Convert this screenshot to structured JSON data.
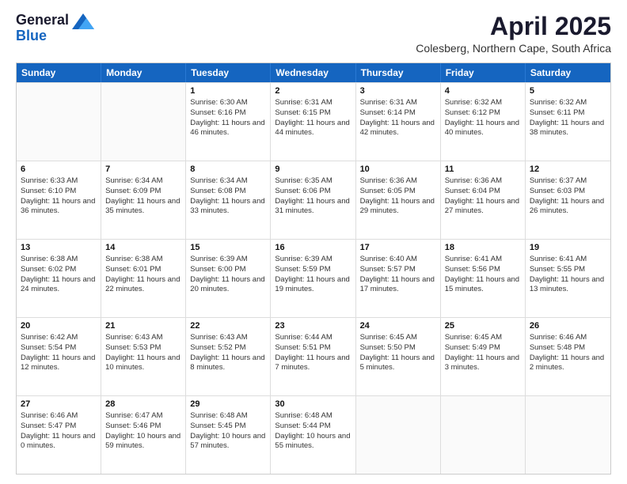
{
  "logo": {
    "line1": "General",
    "line2": "Blue"
  },
  "title": "April 2025",
  "subtitle": "Colesberg, Northern Cape, South Africa",
  "days": [
    "Sunday",
    "Monday",
    "Tuesday",
    "Wednesday",
    "Thursday",
    "Friday",
    "Saturday"
  ],
  "weeks": [
    [
      {
        "num": "",
        "sunrise": "",
        "sunset": "",
        "daylight": ""
      },
      {
        "num": "",
        "sunrise": "",
        "sunset": "",
        "daylight": ""
      },
      {
        "num": "1",
        "sunrise": "Sunrise: 6:30 AM",
        "sunset": "Sunset: 6:16 PM",
        "daylight": "Daylight: 11 hours and 46 minutes."
      },
      {
        "num": "2",
        "sunrise": "Sunrise: 6:31 AM",
        "sunset": "Sunset: 6:15 PM",
        "daylight": "Daylight: 11 hours and 44 minutes."
      },
      {
        "num": "3",
        "sunrise": "Sunrise: 6:31 AM",
        "sunset": "Sunset: 6:14 PM",
        "daylight": "Daylight: 11 hours and 42 minutes."
      },
      {
        "num": "4",
        "sunrise": "Sunrise: 6:32 AM",
        "sunset": "Sunset: 6:12 PM",
        "daylight": "Daylight: 11 hours and 40 minutes."
      },
      {
        "num": "5",
        "sunrise": "Sunrise: 6:32 AM",
        "sunset": "Sunset: 6:11 PM",
        "daylight": "Daylight: 11 hours and 38 minutes."
      }
    ],
    [
      {
        "num": "6",
        "sunrise": "Sunrise: 6:33 AM",
        "sunset": "Sunset: 6:10 PM",
        "daylight": "Daylight: 11 hours and 36 minutes."
      },
      {
        "num": "7",
        "sunrise": "Sunrise: 6:34 AM",
        "sunset": "Sunset: 6:09 PM",
        "daylight": "Daylight: 11 hours and 35 minutes."
      },
      {
        "num": "8",
        "sunrise": "Sunrise: 6:34 AM",
        "sunset": "Sunset: 6:08 PM",
        "daylight": "Daylight: 11 hours and 33 minutes."
      },
      {
        "num": "9",
        "sunrise": "Sunrise: 6:35 AM",
        "sunset": "Sunset: 6:06 PM",
        "daylight": "Daylight: 11 hours and 31 minutes."
      },
      {
        "num": "10",
        "sunrise": "Sunrise: 6:36 AM",
        "sunset": "Sunset: 6:05 PM",
        "daylight": "Daylight: 11 hours and 29 minutes."
      },
      {
        "num": "11",
        "sunrise": "Sunrise: 6:36 AM",
        "sunset": "Sunset: 6:04 PM",
        "daylight": "Daylight: 11 hours and 27 minutes."
      },
      {
        "num": "12",
        "sunrise": "Sunrise: 6:37 AM",
        "sunset": "Sunset: 6:03 PM",
        "daylight": "Daylight: 11 hours and 26 minutes."
      }
    ],
    [
      {
        "num": "13",
        "sunrise": "Sunrise: 6:38 AM",
        "sunset": "Sunset: 6:02 PM",
        "daylight": "Daylight: 11 hours and 24 minutes."
      },
      {
        "num": "14",
        "sunrise": "Sunrise: 6:38 AM",
        "sunset": "Sunset: 6:01 PM",
        "daylight": "Daylight: 11 hours and 22 minutes."
      },
      {
        "num": "15",
        "sunrise": "Sunrise: 6:39 AM",
        "sunset": "Sunset: 6:00 PM",
        "daylight": "Daylight: 11 hours and 20 minutes."
      },
      {
        "num": "16",
        "sunrise": "Sunrise: 6:39 AM",
        "sunset": "Sunset: 5:59 PM",
        "daylight": "Daylight: 11 hours and 19 minutes."
      },
      {
        "num": "17",
        "sunrise": "Sunrise: 6:40 AM",
        "sunset": "Sunset: 5:57 PM",
        "daylight": "Daylight: 11 hours and 17 minutes."
      },
      {
        "num": "18",
        "sunrise": "Sunrise: 6:41 AM",
        "sunset": "Sunset: 5:56 PM",
        "daylight": "Daylight: 11 hours and 15 minutes."
      },
      {
        "num": "19",
        "sunrise": "Sunrise: 6:41 AM",
        "sunset": "Sunset: 5:55 PM",
        "daylight": "Daylight: 11 hours and 13 minutes."
      }
    ],
    [
      {
        "num": "20",
        "sunrise": "Sunrise: 6:42 AM",
        "sunset": "Sunset: 5:54 PM",
        "daylight": "Daylight: 11 hours and 12 minutes."
      },
      {
        "num": "21",
        "sunrise": "Sunrise: 6:43 AM",
        "sunset": "Sunset: 5:53 PM",
        "daylight": "Daylight: 11 hours and 10 minutes."
      },
      {
        "num": "22",
        "sunrise": "Sunrise: 6:43 AM",
        "sunset": "Sunset: 5:52 PM",
        "daylight": "Daylight: 11 hours and 8 minutes."
      },
      {
        "num": "23",
        "sunrise": "Sunrise: 6:44 AM",
        "sunset": "Sunset: 5:51 PM",
        "daylight": "Daylight: 11 hours and 7 minutes."
      },
      {
        "num": "24",
        "sunrise": "Sunrise: 6:45 AM",
        "sunset": "Sunset: 5:50 PM",
        "daylight": "Daylight: 11 hours and 5 minutes."
      },
      {
        "num": "25",
        "sunrise": "Sunrise: 6:45 AM",
        "sunset": "Sunset: 5:49 PM",
        "daylight": "Daylight: 11 hours and 3 minutes."
      },
      {
        "num": "26",
        "sunrise": "Sunrise: 6:46 AM",
        "sunset": "Sunset: 5:48 PM",
        "daylight": "Daylight: 11 hours and 2 minutes."
      }
    ],
    [
      {
        "num": "27",
        "sunrise": "Sunrise: 6:46 AM",
        "sunset": "Sunset: 5:47 PM",
        "daylight": "Daylight: 11 hours and 0 minutes."
      },
      {
        "num": "28",
        "sunrise": "Sunrise: 6:47 AM",
        "sunset": "Sunset: 5:46 PM",
        "daylight": "Daylight: 10 hours and 59 minutes."
      },
      {
        "num": "29",
        "sunrise": "Sunrise: 6:48 AM",
        "sunset": "Sunset: 5:45 PM",
        "daylight": "Daylight: 10 hours and 57 minutes."
      },
      {
        "num": "30",
        "sunrise": "Sunrise: 6:48 AM",
        "sunset": "Sunset: 5:44 PM",
        "daylight": "Daylight: 10 hours and 55 minutes."
      },
      {
        "num": "",
        "sunrise": "",
        "sunset": "",
        "daylight": ""
      },
      {
        "num": "",
        "sunrise": "",
        "sunset": "",
        "daylight": ""
      },
      {
        "num": "",
        "sunrise": "",
        "sunset": "",
        "daylight": ""
      }
    ]
  ]
}
